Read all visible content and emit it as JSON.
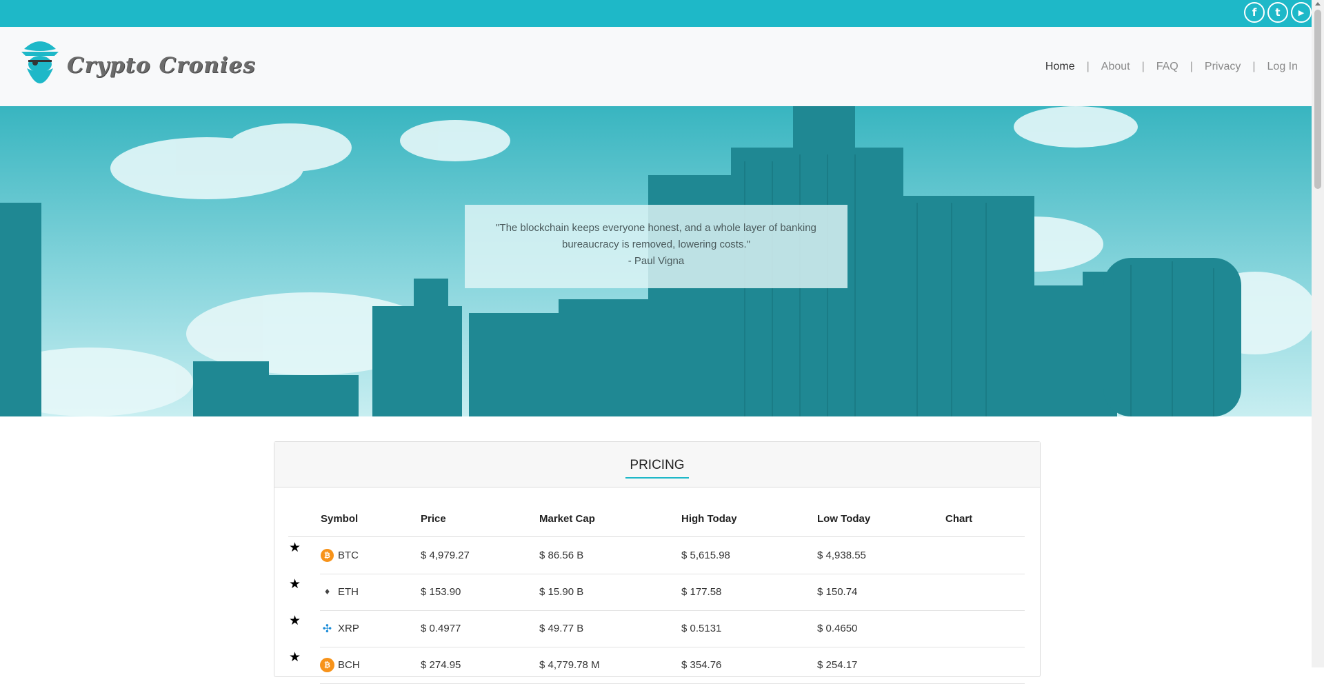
{
  "social": [
    {
      "icon": "facebook-icon",
      "glyph": "f"
    },
    {
      "icon": "twitter-icon",
      "glyph": "t"
    },
    {
      "icon": "youtube-icon",
      "glyph": "▶"
    }
  ],
  "brand": {
    "name": "Crypto Cronies",
    "accent": "#1eb8c8"
  },
  "nav": {
    "items": [
      {
        "label": "Home",
        "active": true
      },
      {
        "label": "About"
      },
      {
        "label": "FAQ"
      },
      {
        "label": "Privacy"
      },
      {
        "label": "Log In"
      }
    ],
    "separator": "|"
  },
  "hero": {
    "quote_line1": "\"The blockchain keeps everyone honest, and a whole layer of banking",
    "quote_line2": "bureaucracy is removed, lowering costs.\"",
    "author": "- Paul Vigna"
  },
  "pricing": {
    "title": "PRICING",
    "columns": [
      "Symbol",
      "Price",
      "Market Cap",
      "High Today",
      "Low Today",
      "Chart"
    ],
    "rows": [
      {
        "symbol": "BTC",
        "icon": "bitcoin-icon",
        "icon_color": "#f7931a",
        "glyph": "₿",
        "price": "$ 4,979.27",
        "market_cap": "$ 86.56 B",
        "high": "$ 5,615.98",
        "low": "$ 4,938.55"
      },
      {
        "symbol": "ETH",
        "icon": "ethereum-icon",
        "icon_color": "#ffffff",
        "glyph": "♦",
        "price": "$ 153.90",
        "market_cap": "$ 15.90 B",
        "high": "$ 177.58",
        "low": "$ 150.74"
      },
      {
        "symbol": "XRP",
        "icon": "ripple-icon",
        "icon_color": "#ffffff",
        "glyph": "✣",
        "price": "$ 0.4977",
        "market_cap": "$ 49.77 B",
        "high": "$ 0.5131",
        "low": "$ 0.4650"
      },
      {
        "symbol": "BCH",
        "icon": "bitcoin-cash-icon",
        "icon_color": "#f7931a",
        "glyph": "₿",
        "price": "$ 274.95",
        "market_cap": "$ 4,779.78 M",
        "high": "$ 354.76",
        "low": "$ 254.17"
      }
    ],
    "favorite_glyph": "★"
  }
}
